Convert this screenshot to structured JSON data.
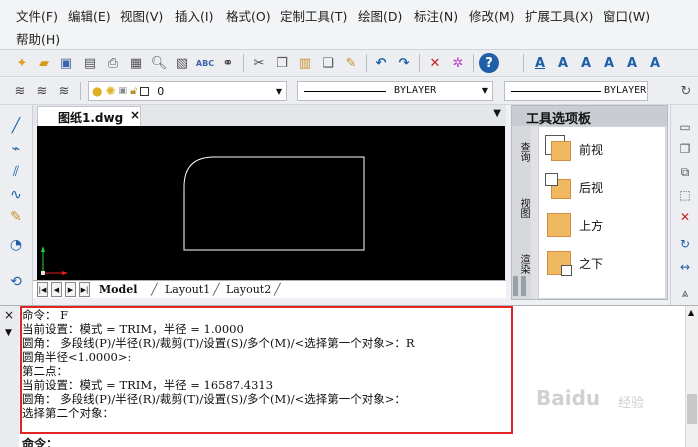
{
  "menu": [
    {
      "label": "文件(F)"
    },
    {
      "label": "编辑(E)"
    },
    {
      "label": "视图(V)"
    },
    {
      "label": "插入(I)"
    },
    {
      "label": "格式(O)"
    },
    {
      "label": "定制工具(T)"
    },
    {
      "label": "绘图(D)"
    },
    {
      "label": "标注(N)"
    },
    {
      "label": "修改(M)"
    },
    {
      "label": "扩展工具(X)"
    },
    {
      "label": "窗口(W)"
    },
    {
      "label": "帮助(H)"
    }
  ],
  "properties": {
    "layer_value": "0",
    "linetype_value": "BYLAYER",
    "lineweight_value": "BYLAYER"
  },
  "document": {
    "tab_title": "图纸1.dwg",
    "close_glyph": "×"
  },
  "layouts": [
    {
      "label": "Model"
    },
    {
      "label": "Layout1"
    },
    {
      "label": "Layout2"
    }
  ],
  "palette": {
    "title": "工具选项板",
    "side_tabs": [
      "查询",
      "视图",
      "渲染"
    ],
    "items": [
      {
        "label": "前视"
      },
      {
        "label": "后视"
      },
      {
        "label": "上方"
      },
      {
        "label": "之下"
      }
    ]
  },
  "command": {
    "lines": [
      "命令： F",
      "当前设置：模式 = TRIM，半径 = 1.0000",
      "圆角： 多段线(P)/半径(R)/裁剪(T)/设置(S)/多个(M)/<选择第一个对象>：R",
      "圆角半径<1.0000>:",
      "第二点：",
      "当前设置：模式 = TRIM，半径 = 16587.4313",
      "圆角： 多段线(P)/半径(R)/裁剪(T)/设置(S)/多个(M)/<选择第一个对象>：",
      "选择第二个对象："
    ],
    "prompt": "命令："
  },
  "watermark": {
    "text": "Baidu",
    "sub": "经验"
  },
  "colors": {
    "highlight": "#e12424",
    "canvas": "#000000",
    "accent": "#1f5fa8"
  }
}
